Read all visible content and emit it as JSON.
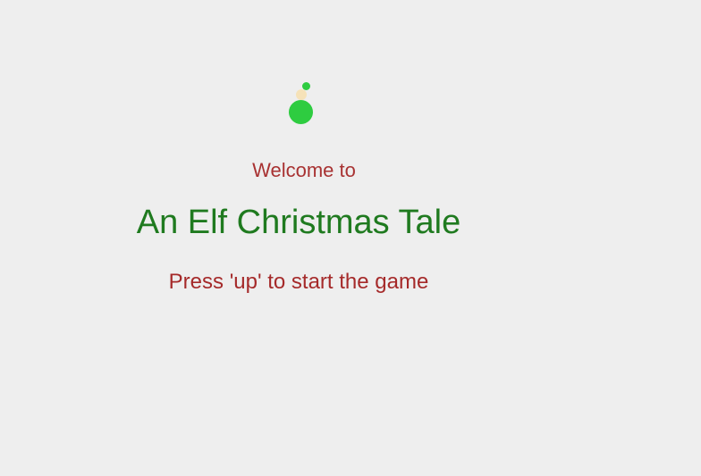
{
  "screen": {
    "welcome_text": "Welcome to",
    "title": "An Elf Christmas Tale",
    "prompt": "Press 'up' to start the game"
  },
  "sprite": {
    "name": "elf-icon",
    "colors": {
      "hat": "#2ecc40",
      "face": "#f6e2b8",
      "body": "#2ecc40"
    }
  },
  "colors": {
    "background": "#eeeeee",
    "welcome": "#a83232",
    "title": "#1f7a1f",
    "prompt": "#a52a2a"
  }
}
